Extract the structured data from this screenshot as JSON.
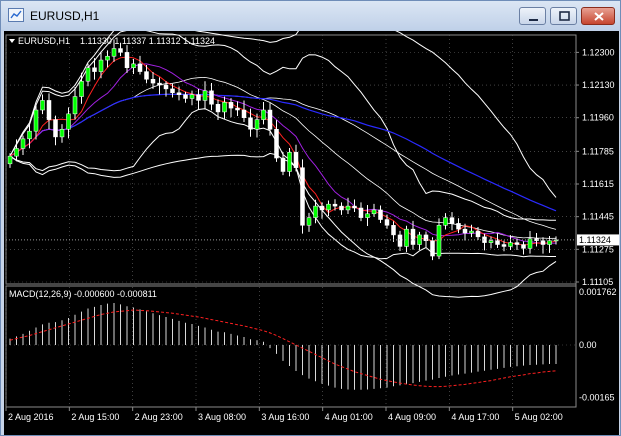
{
  "window": {
    "title": "EURUSD,H1"
  },
  "header": {
    "symbol": "EURUSD,H1",
    "ohlc": "1.11330 1.11337 1.11312 1.11324"
  },
  "price_panel": {
    "ticks": [
      {
        "label": "1.12300",
        "value": 1.123
      },
      {
        "label": "1.12130",
        "value": 1.1213
      },
      {
        "label": "1.11960",
        "value": 1.1196
      },
      {
        "label": "1.11785",
        "value": 1.11785
      },
      {
        "label": "1.11615",
        "value": 1.11615
      },
      {
        "label": "1.11445",
        "value": 1.11445
      },
      {
        "label": "1.11275",
        "value": 1.11275
      },
      {
        "label": "1.11105",
        "value": 1.11105
      }
    ],
    "current_price": {
      "label": "1.11324",
      "value": 1.11324
    }
  },
  "macd_panel": {
    "label": "MACD(12,26,9) -0.000600 -0.000811",
    "ticks": [
      {
        "label": "0.001762",
        "value": 0.001762
      },
      {
        "label": "0.00",
        "value": 0.0
      },
      {
        "label": "-0.00165",
        "value": -0.00165
      }
    ]
  },
  "time_axis": [
    "2 Aug 2016",
    "2 Aug 15:00",
    "2 Aug 23:00",
    "3 Aug 08:00",
    "3 Aug 16:00",
    "4 Aug 01:00",
    "4 Aug 09:00",
    "4 Aug 17:00",
    "5 Aug 02:00"
  ],
  "colors": {
    "bull": "#00ff00",
    "bear": "#ffffff",
    "ma_fast": "#ff2020",
    "ma_mid": "#a020e0",
    "ma_slow": "#2a2aff",
    "bands": "#ffffff",
    "signal": "#ff2020",
    "grid": "#6a6a6a"
  },
  "chart_data": [
    {
      "type": "candlestick",
      "title": "EURUSD,H1",
      "y_range": [
        1.11105,
        1.1238
      ],
      "close": [
        1.1176,
        1.118,
        1.1185,
        1.1189,
        1.12,
        1.1205,
        1.1195,
        1.1186,
        1.119,
        1.1198,
        1.1207,
        1.1215,
        1.1222,
        1.122,
        1.1226,
        1.1228,
        1.1232,
        1.123,
        1.1222,
        1.1224,
        1.122,
        1.1216,
        1.1214,
        1.1213,
        1.1211,
        1.1209,
        1.1208,
        1.1206,
        1.1208,
        1.1205,
        1.121,
        1.1203,
        1.1199,
        1.1204,
        1.1201,
        1.12,
        1.1196,
        1.119,
        1.1195,
        1.12,
        1.119,
        1.1175,
        1.1168,
        1.1178,
        1.117,
        1.114,
        1.1144,
        1.115,
        1.1148,
        1.1151,
        1.115,
        1.1148,
        1.115,
        1.1149,
        1.1144,
        1.1146,
        1.1148,
        1.1143,
        1.114,
        1.1135,
        1.1129,
        1.1138,
        1.113,
        1.1135,
        1.1132,
        1.1124,
        1.114,
        1.1144,
        1.1141,
        1.1138,
        1.1136,
        1.1137,
        1.1134,
        1.1131,
        1.1132,
        1.113,
        1.1129,
        1.1131,
        1.113,
        1.1128,
        1.1133,
        1.1132,
        1.113,
        1.1132,
        1.11324
      ]
    },
    {
      "type": "bar",
      "title": "MACD(12,26,9) -0.000600 -0.000811",
      "y_range": [
        -0.00192,
        0.001762
      ],
      "values": [
        0.0002,
        0.00027,
        0.00035,
        0.00045,
        0.00055,
        0.00065,
        0.0007,
        0.00072,
        0.00078,
        0.00085,
        0.00095,
        0.00105,
        0.00115,
        0.0012,
        0.00126,
        0.0013,
        0.00132,
        0.00128,
        0.00122,
        0.00118,
        0.00112,
        0.00106,
        0.001,
        0.00094,
        0.00088,
        0.00082,
        0.00076,
        0.0007,
        0.00066,
        0.0006,
        0.00055,
        0.00048,
        0.00042,
        0.0004,
        0.00035,
        0.0003,
        0.00025,
        0.00018,
        0.00015,
        0.0001,
        -0.0001,
        -0.00028,
        -0.0005,
        -0.00066,
        -0.00082,
        -0.00095,
        -0.00106,
        -0.00114,
        -0.00122,
        -0.00128,
        -0.00134,
        -0.00138,
        -0.0014,
        -0.00141,
        -0.00141,
        -0.0014,
        -0.00138,
        -0.00136,
        -0.00134,
        -0.0013,
        -0.00127,
        -0.00123,
        -0.0012,
        -0.00116,
        -0.00112,
        -0.00109,
        -0.00104,
        -0.001,
        -0.00096,
        -0.00093,
        -0.0009,
        -0.00087,
        -0.00084,
        -0.00081,
        -0.00078,
        -0.00075,
        -0.00072,
        -0.00069,
        -0.00067,
        -0.00065,
        -0.00063,
        -0.00062,
        -0.00061,
        -0.0006,
        -0.0006
      ],
      "signal": [
        0.00015,
        0.0002,
        0.00025,
        0.0003,
        0.00036,
        0.00042,
        0.00048,
        0.00054,
        0.0006,
        0.00066,
        0.00072,
        0.00078,
        0.00084,
        0.0009,
        0.00096,
        0.001,
        0.00104,
        0.00106,
        0.00108,
        0.0011,
        0.00109,
        0.00108,
        0.00106,
        0.00104,
        0.00102,
        0.001,
        0.00097,
        0.00094,
        0.00091,
        0.00088,
        0.00084,
        0.0008,
        0.00076,
        0.00072,
        0.00068,
        0.00064,
        0.0006,
        0.00055,
        0.0005,
        0.00045,
        0.00038,
        0.0003,
        0.0002,
        0.0001,
        0.0,
        -0.0001,
        -0.0002,
        -0.0003,
        -0.0004,
        -0.0005,
        -0.0006,
        -0.00068,
        -0.00076,
        -0.00084,
        -0.0009,
        -0.00096,
        -0.00102,
        -0.00108,
        -0.00112,
        -0.00116,
        -0.0012,
        -0.00123,
        -0.00126,
        -0.00128,
        -0.0013,
        -0.00131,
        -0.00131,
        -0.0013,
        -0.00128,
        -0.00126,
        -0.00124,
        -0.00121,
        -0.00118,
        -0.00115,
        -0.00112,
        -0.00108,
        -0.00104,
        -0.001,
        -0.00097,
        -0.00094,
        -0.0009,
        -0.00088,
        -0.00085,
        -0.00083,
        -0.000811
      ]
    }
  ]
}
